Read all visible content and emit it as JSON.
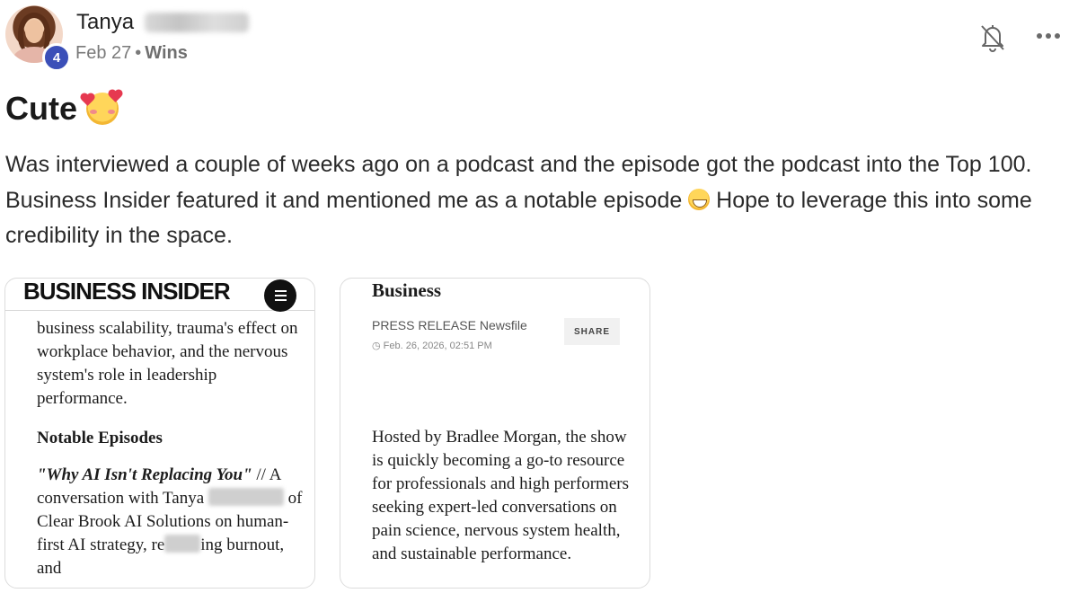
{
  "author": {
    "name": "Tanya",
    "level": "4"
  },
  "meta": {
    "date": "Feb 27",
    "separator": "•",
    "category": "Wins"
  },
  "post": {
    "title": "Cute",
    "title_emoji": "smiling-face-with-hearts",
    "body_part1": "Was interviewed a couple of weeks ago on a podcast and the episode got the podcast into the Top 100. Business Insider featured it and mentioned me as a notable episode",
    "body_emoji": "grinning-face",
    "body_part2": "Hope to leverage this into some credibility in the space."
  },
  "icons": {
    "bell": "bell-off-icon",
    "more": "more-horizontal-icon"
  },
  "cards": {
    "business_insider": {
      "logo": "BUSINESS INSIDER",
      "paragraph1": "business scalability, trauma's effect on workplace behavior, and the nervous system's role in leadership performance.",
      "heading": "Notable Episodes",
      "episode_title": "\"Why AI Isn't Replacing You\"",
      "episode_sep": "//",
      "desc_a": "A conversation with Tanya",
      "desc_b": "of Clear Brook AI Solutions on human-first AI strategy, re",
      "desc_c": "ing burnout, and"
    },
    "newsfile": {
      "section": "Business",
      "kicker": "PRESS RELEASE Newsfile",
      "date": "Feb. 26, 2026, 02:51 PM",
      "share": "SHARE",
      "body": "Hosted by Bradlee Morgan, the show is quickly becoming a go-to resource for professionals and high performers seeking expert-led conversations on pain science, nervous system health, and sustainable performance."
    }
  }
}
